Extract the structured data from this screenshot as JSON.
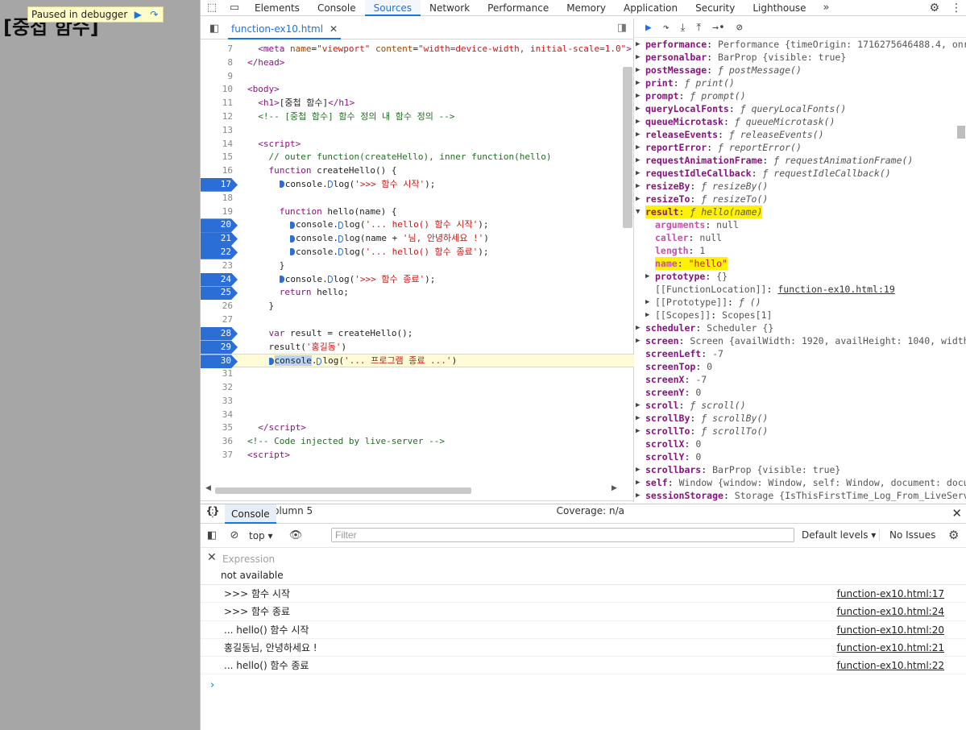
{
  "page": {
    "heading": "[중첩 함수]",
    "paused_label": "Paused in debugger"
  },
  "devtools": {
    "tabs": [
      "Elements",
      "Console",
      "Sources",
      "Network",
      "Performance",
      "Memory",
      "Application",
      "Security",
      "Lighthouse"
    ],
    "active_tab": "Sources",
    "file_tab": "function-ex10.html",
    "status": {
      "position": "Line 30, Column 5",
      "coverage": "Coverage: n/a"
    }
  },
  "code_lines": [
    {
      "n": "7",
      "bp": false,
      "html": "  <span class=\"tg\">&lt;meta</span> <span class=\"at\">name</span>=<span class=\"st\">\"viewport\"</span> <span class=\"at\">content</span>=<span class=\"st\">\"width=device-width, initial-scale=1.0\"</span><span class=\"tg\">&gt;</span>"
    },
    {
      "n": "8",
      "bp": false,
      "html": "<span class=\"tg\">&lt;/head&gt;</span>"
    },
    {
      "n": "9",
      "bp": false,
      "html": ""
    },
    {
      "n": "10",
      "bp": false,
      "html": "<span class=\"tg\">&lt;body&gt;</span>"
    },
    {
      "n": "11",
      "bp": false,
      "html": "  <span class=\"tg\">&lt;h1&gt;</span>[중첩 함수]<span class=\"tg\">&lt;/h1&gt;</span>"
    },
    {
      "n": "12",
      "bp": false,
      "html": "  <span class=\"cm\">&lt;!-- [중첩 함수] 함수 정의 내 함수 정의 --&gt;</span>"
    },
    {
      "n": "13",
      "bp": false,
      "html": ""
    },
    {
      "n": "14",
      "bp": false,
      "html": "  <span class=\"tg\">&lt;script&gt;</span>"
    },
    {
      "n": "15",
      "bp": false,
      "html": "    <span class=\"cm\">// outer function(createHello), inner function(hello)</span>"
    },
    {
      "n": "16",
      "bp": false,
      "html": "    <span class=\"kw\">function</span> createHello() {"
    },
    {
      "n": "17",
      "bp": true,
      "html": "      <span class=\"mk\"></span>console.<span class=\"mk o\"></span>log(<span class=\"st\">'&gt;&gt;&gt; 함수 시작'</span>);"
    },
    {
      "n": "18",
      "bp": false,
      "html": ""
    },
    {
      "n": "19",
      "bp": false,
      "html": "      <span class=\"kw\">function</span> hello(name) {"
    },
    {
      "n": "20",
      "bp": true,
      "html": "        <span class=\"mk\"></span>console.<span class=\"mk o\"></span>log(<span class=\"st\">'... hello() 함수 시작'</span>);"
    },
    {
      "n": "21",
      "bp": true,
      "html": "        <span class=\"mk\"></span>console.<span class=\"mk o\"></span>log(name + <span class=\"st\">'님, 안녕하세요 !'</span>)"
    },
    {
      "n": "22",
      "bp": true,
      "html": "        <span class=\"mk\"></span>console.<span class=\"mk o\"></span>log(<span class=\"st\">'... hello() 함수 종료'</span>);"
    },
    {
      "n": "23",
      "bp": false,
      "html": "      }"
    },
    {
      "n": "24",
      "bp": true,
      "html": "      <span class=\"mk\"></span>console.<span class=\"mk o\"></span>log(<span class=\"st\">'&gt;&gt;&gt; 함수 종료'</span>);"
    },
    {
      "n": "25",
      "bp": true,
      "html": "      <span class=\"kw\">return</span> hello;"
    },
    {
      "n": "26",
      "bp": false,
      "html": "    }"
    },
    {
      "n": "27",
      "bp": false,
      "html": ""
    },
    {
      "n": "28",
      "bp": true,
      "html": "    <span class=\"kw\">var</span> result = createHello();"
    },
    {
      "n": "29",
      "bp": true,
      "html": "    result(<span class=\"st\">'홍길동'</span>)"
    },
    {
      "n": "30",
      "bp": true,
      "cur": true,
      "html": "    <span class=\"mk\"></span><span class=\"csel\">console</span>.<span class=\"mk o\"></span>log(<span class=\"st\">'... 프로그램 종료 ...'</span>)"
    },
    {
      "n": "31",
      "bp": false,
      "html": ""
    },
    {
      "n": "32",
      "bp": false,
      "html": ""
    },
    {
      "n": "33",
      "bp": false,
      "html": ""
    },
    {
      "n": "34",
      "bp": false,
      "html": ""
    },
    {
      "n": "35",
      "bp": false,
      "html": "  <span class=\"tg\">&lt;/script&gt;</span>"
    },
    {
      "n": "36",
      "bp": false,
      "html": "<span class=\"cm\">&lt;!-- Code injected by live-server --&gt;</span>"
    },
    {
      "n": "37",
      "bp": false,
      "html": "<span class=\"tg\">&lt;script&gt;</span>"
    }
  ],
  "scope": [
    {
      "ind": 0,
      "arrow": "▶",
      "key": "performance",
      "val": "Performance {timeOrigin: 1716275646488.4, onres"
    },
    {
      "ind": 0,
      "arrow": "▶",
      "key": "personalbar",
      "val": "BarProp {visible: true}"
    },
    {
      "ind": 0,
      "arrow": "▶",
      "key": "postMessage",
      "val": "ƒ postMessage()",
      "it": true
    },
    {
      "ind": 0,
      "arrow": "▶",
      "key": "print",
      "val": "ƒ print()",
      "it": true
    },
    {
      "ind": 0,
      "arrow": "▶",
      "key": "prompt",
      "val": "ƒ prompt()",
      "it": true
    },
    {
      "ind": 0,
      "arrow": "▶",
      "key": "queryLocalFonts",
      "val": "ƒ queryLocalFonts()",
      "it": true
    },
    {
      "ind": 0,
      "arrow": "▶",
      "key": "queueMicrotask",
      "val": "ƒ queueMicrotask()",
      "it": true
    },
    {
      "ind": 0,
      "arrow": "▶",
      "key": "releaseEvents",
      "val": "ƒ releaseEvents()",
      "it": true
    },
    {
      "ind": 0,
      "arrow": "▶",
      "key": "reportError",
      "val": "ƒ reportError()",
      "it": true
    },
    {
      "ind": 0,
      "arrow": "▶",
      "key": "requestAnimationFrame",
      "val": "ƒ requestAnimationFrame()",
      "it": true
    },
    {
      "ind": 0,
      "arrow": "▶",
      "key": "requestIdleCallback",
      "val": "ƒ requestIdleCallback()",
      "it": true
    },
    {
      "ind": 0,
      "arrow": "▶",
      "key": "resizeBy",
      "val": "ƒ resizeBy()",
      "it": true
    },
    {
      "ind": 0,
      "arrow": "▶",
      "key": "resizeTo",
      "val": "ƒ resizeTo()",
      "it": true
    },
    {
      "ind": 0,
      "arrow": "▼",
      "key": "result",
      "val": "ƒ hello(name)",
      "it": true,
      "hl": true
    },
    {
      "ind": 1,
      "arrow": "",
      "key": "arguments",
      "val": "null",
      "dim": true
    },
    {
      "ind": 1,
      "arrow": "",
      "key": "caller",
      "val": "null",
      "dim": true
    },
    {
      "ind": 1,
      "arrow": "",
      "key": "length",
      "val": "1",
      "dim": true
    },
    {
      "ind": 1,
      "arrow": "",
      "key": "name",
      "val": "\"hello\"",
      "dim": true,
      "hl": true
    },
    {
      "ind": 1,
      "arrow": "▶",
      "key": "prototype",
      "val": "{}"
    },
    {
      "ind": 1,
      "arrow": "",
      "key": "[[FunctionLocation]]",
      "val": "function-ex10.html:19",
      "int": true,
      "link": true
    },
    {
      "ind": 1,
      "arrow": "▶",
      "key": "[[Prototype]]",
      "val": "ƒ ()",
      "int": true,
      "it": true
    },
    {
      "ind": 1,
      "arrow": "▶",
      "key": "[[Scopes]]",
      "val": "Scopes[1]",
      "int": true
    },
    {
      "ind": 0,
      "arrow": "▶",
      "key": "scheduler",
      "val": "Scheduler {}"
    },
    {
      "ind": 0,
      "arrow": "▶",
      "key": "screen",
      "val": "Screen {availWidth: 1920, availHeight: 1040, width: 1"
    },
    {
      "ind": 0,
      "arrow": "",
      "key": "screenLeft",
      "val": "-7"
    },
    {
      "ind": 0,
      "arrow": "",
      "key": "screenTop",
      "val": "0"
    },
    {
      "ind": 0,
      "arrow": "",
      "key": "screenX",
      "val": "-7"
    },
    {
      "ind": 0,
      "arrow": "",
      "key": "screenY",
      "val": "0"
    },
    {
      "ind": 0,
      "arrow": "▶",
      "key": "scroll",
      "val": "ƒ scroll()",
      "it": true
    },
    {
      "ind": 0,
      "arrow": "▶",
      "key": "scrollBy",
      "val": "ƒ scrollBy()",
      "it": true
    },
    {
      "ind": 0,
      "arrow": "▶",
      "key": "scrollTo",
      "val": "ƒ scrollTo()",
      "it": true
    },
    {
      "ind": 0,
      "arrow": "",
      "key": "scrollX",
      "val": "0"
    },
    {
      "ind": 0,
      "arrow": "",
      "key": "scrollY",
      "val": "0"
    },
    {
      "ind": 0,
      "arrow": "▶",
      "key": "scrollbars",
      "val": "BarProp {visible: true}"
    },
    {
      "ind": 0,
      "arrow": "▶",
      "key": "self",
      "val": "Window {window: Window, self: Window, document: documen"
    },
    {
      "ind": 0,
      "arrow": "▶",
      "key": "sessionStorage",
      "val": "Storage {IsThisFirstTime_Log_From_LiveServe"
    }
  ],
  "console": {
    "tab": "Console",
    "context": "top",
    "filter_placeholder": "Filter",
    "levels": "Default levels",
    "issues": "No Issues",
    "expression_label": "Expression",
    "expression_value": "not available",
    "messages": [
      {
        "text": ">>> 함수 시작",
        "src": "function-ex10.html:17"
      },
      {
        "text": ">>> 함수 종료",
        "src": "function-ex10.html:24"
      },
      {
        "text": "... hello() 함수 시작",
        "src": "function-ex10.html:20"
      },
      {
        "text": "홍길동님, 안녕하세요 !",
        "src": "function-ex10.html:21"
      },
      {
        "text": "... hello() 함수 종료",
        "src": "function-ex10.html:22"
      }
    ]
  }
}
